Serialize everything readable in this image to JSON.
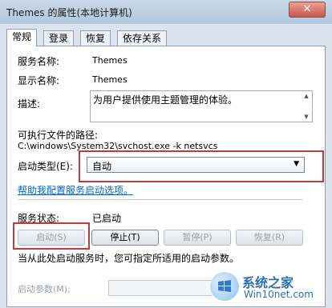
{
  "window": {
    "title": "Themes 的属性(本地计算机)",
    "close_glyph": "✕"
  },
  "tabs": [
    {
      "label": "常规",
      "active": true
    },
    {
      "label": "登录",
      "active": false
    },
    {
      "label": "恢复",
      "active": false
    },
    {
      "label": "依存关系",
      "active": false
    }
  ],
  "general": {
    "service_name_label": "服务名称:",
    "service_name_value": "Themes",
    "display_name_label": "显示名称:",
    "display_name_value": "Themes",
    "description_label": "描述:",
    "description_value": "为用户提供使用主题管理的体验。",
    "exe_path_label": "可执行文件的路径:",
    "exe_path_value": "C:\\windows\\System32\\svchost.exe -k netsvcs",
    "startup_type_label": "启动类型(E):",
    "startup_type_value": "自动",
    "help_link": "帮助我配置服务启动选项。",
    "status_label": "服务状态:",
    "status_value": "已启动",
    "hint_text": "当从此处启动服务时，您可指定所适用的启动参数。",
    "start_params_label": "启动参数(M):",
    "start_params_value": ""
  },
  "buttons": {
    "start": "启动(S)",
    "stop": "停止(T)",
    "pause": "暂停(P)",
    "resume": "恢复(R)"
  },
  "watermark": {
    "brand": "系统之家",
    "site": "Win10net.com"
  },
  "colors": {
    "highlight": "#c43a3a",
    "link": "#0066cc"
  }
}
